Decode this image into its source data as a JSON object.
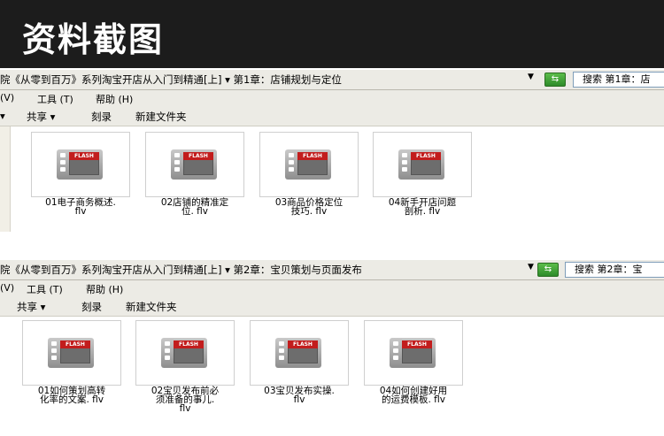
{
  "banner": {
    "title": "资料截图"
  },
  "windows": [
    {
      "path": "院《从零到百万》系列淘宝开店从入门到精通[上] ▾ 第1章：店铺规划与定位",
      "search": "搜索 第1章：店",
      "menu": [
        "(V)",
        "工具 (T)",
        "帮助 (H)"
      ],
      "toolbar": {
        "share": "共享 ▾",
        "burn": "刻录",
        "newfolder": "新建文件夹"
      },
      "files": [
        {
          "line1": "01电子商务概述.",
          "line2": "flv"
        },
        {
          "line1": "02店铺的精准定",
          "line2": "位. flv"
        },
        {
          "line1": "03商品价格定位",
          "line2": "技巧. flv"
        },
        {
          "line1": "04新手开店问题",
          "line2": "剖析. flv"
        }
      ]
    },
    {
      "path": "院《从零到百万》系列淘宝开店从入门到精通[上] ▾ 第2章：宝贝策划与页面发布",
      "search": "搜索 第2章：宝",
      "menu": [
        "(V)",
        "工具 (T)",
        "帮助 (H)"
      ],
      "toolbar": {
        "share": "共享 ▾",
        "burn": "刻录",
        "newfolder": "新建文件夹"
      },
      "files": [
        {
          "line1": "01如何策划高转",
          "line2": "化率的文案. flv"
        },
        {
          "line1": "02宝贝发布前必",
          "line2": "须准备的事儿.",
          "line3": "flv"
        },
        {
          "line1": "03宝贝发布实操.",
          "line2": "flv"
        },
        {
          "line1": "04如何创建好用",
          "line2": "的运费模板. flv"
        }
      ]
    }
  ],
  "icons": {
    "file": "flash-video-icon",
    "tag": "FLASH",
    "go": "green-go-arrow-icon"
  },
  "colors": {
    "banner": "#1c1c1c",
    "chrome": "#ecebe5",
    "flash": "#c21d1d"
  }
}
